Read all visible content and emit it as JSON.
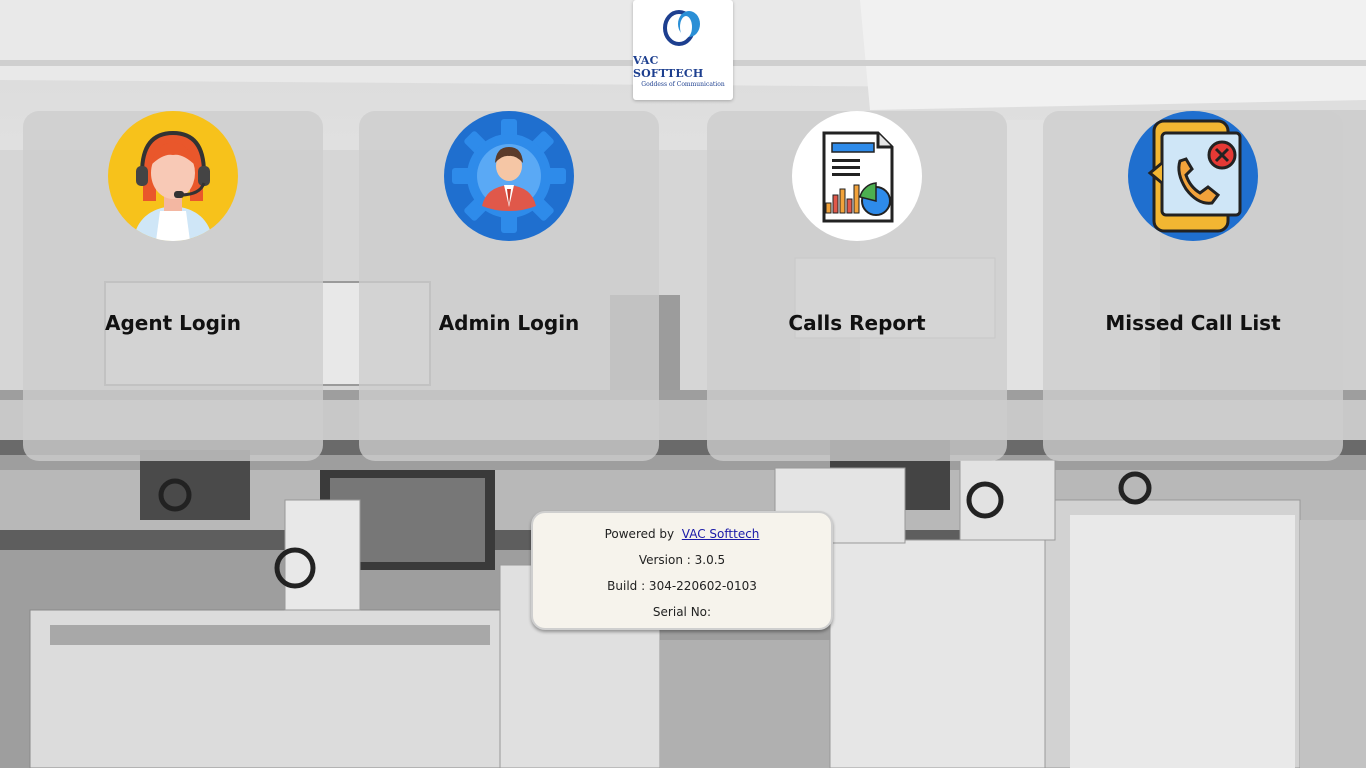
{
  "logo": {
    "title": "VAC SOFTTECH",
    "tagline": "Goddess of Communication"
  },
  "cards": [
    {
      "label": "Agent Login",
      "icon": "call-center-agent-icon"
    },
    {
      "label": "Admin Login",
      "icon": "admin-gear-icon"
    },
    {
      "label": "Calls Report",
      "icon": "report-document-icon"
    },
    {
      "label": "Missed Call List",
      "icon": "missed-call-icon"
    }
  ],
  "info": {
    "powered_by_label": "Powered by",
    "powered_by_link": "VAC Softtech",
    "version": "Version : 3.0.5",
    "build": "Build : 304-220602-0103",
    "serial": "Serial No:"
  },
  "colors": {
    "brand_blue": "#1d3f8f",
    "link": "#1a1aa8",
    "card_bg": "#cdcdcd",
    "info_bg": "#f6f3ec"
  }
}
